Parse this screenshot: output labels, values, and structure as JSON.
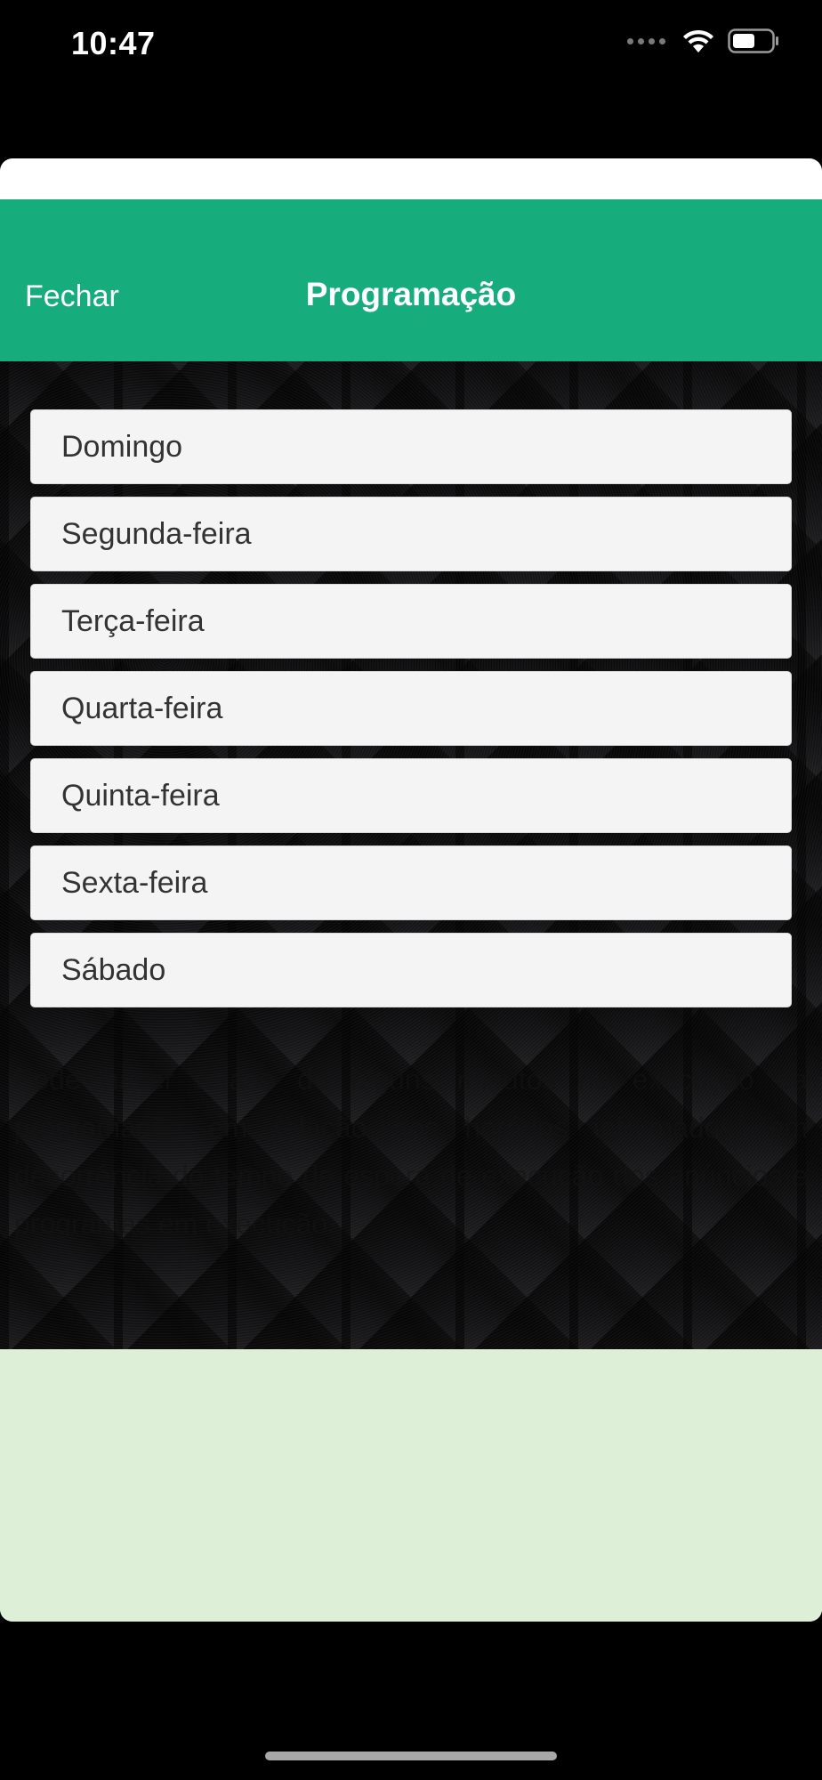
{
  "status_bar": {
    "time": "10:47",
    "icons": [
      "signal-dots-icon",
      "wifi-icon",
      "battery-icon"
    ]
  },
  "header": {
    "close_label": "Fechar",
    "title": "Programação"
  },
  "days": [
    {
      "label": "Domingo"
    },
    {
      "label": "Segunda-feira"
    },
    {
      "label": "Terça-feira"
    },
    {
      "label": "Quarta-feira"
    },
    {
      "label": "Quinta-feira"
    },
    {
      "label": "Sexta-feira"
    },
    {
      "label": "Sábado"
    }
  ],
  "notice": {
    "text": "Pode haver atraso de alguns minutos na execução da programação em relação aos horários informados, em decorrência do tempo de espera de execução dos anúncios e programas em execução."
  },
  "colors": {
    "header": "#17ac7b",
    "footer_panel": "#ddefd6",
    "list_item": "#f4f4f4"
  }
}
